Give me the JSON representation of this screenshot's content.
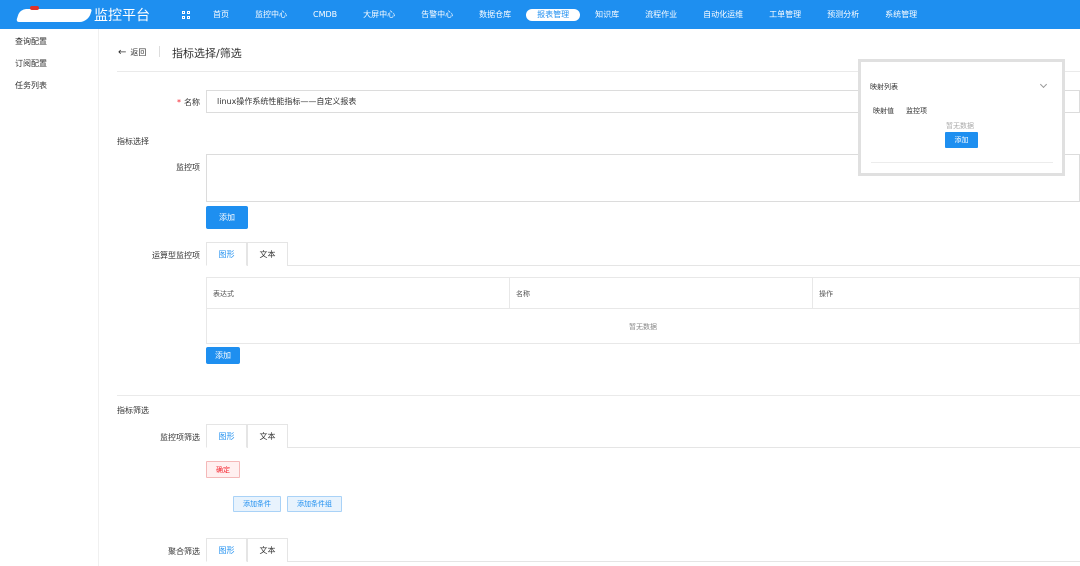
{
  "app": {
    "title": "监控平台"
  },
  "nav": {
    "items": [
      "首页",
      "监控中心",
      "CMDB",
      "大屏中心",
      "告警中心",
      "数据仓库",
      "报表管理",
      "知识库",
      "流程作业",
      "自动化运维",
      "工单管理",
      "预测分析",
      "系统管理"
    ],
    "active": "报表管理"
  },
  "sidebar": {
    "items": [
      "查询配置",
      "订阅配置",
      "任务列表"
    ]
  },
  "header": {
    "back_label": "返回",
    "title": "指标选择/筛选"
  },
  "form": {
    "name_label": "名称",
    "name_value": "linux操作系统性能指标——自定义报表",
    "section_metric_select": "指标选择",
    "monitor_item_label": "监控项",
    "add_label": "添加",
    "calc_monitor_label": "运算型监控项",
    "tab_graph": "图形",
    "tab_text": "文本",
    "table_headers": [
      "表达式",
      "名称",
      "操作"
    ],
    "empty_text": "暂无数据",
    "section_metric_filter": "指标筛选",
    "monitor_filter_label": "监控项筛选",
    "confirm_label": "确定",
    "add_condition_label": "添加条件",
    "add_condition_group_label": "添加条件组",
    "aggregate_filter_label": "聚合筛选"
  },
  "mapping_panel": {
    "title": "映射列表",
    "col_value": "映射值",
    "col_monitor": "监控项",
    "empty_text": "暂无数据",
    "add_label": "添加"
  },
  "colors": {
    "primary": "#1e8ff0",
    "danger": "#f5222d"
  }
}
